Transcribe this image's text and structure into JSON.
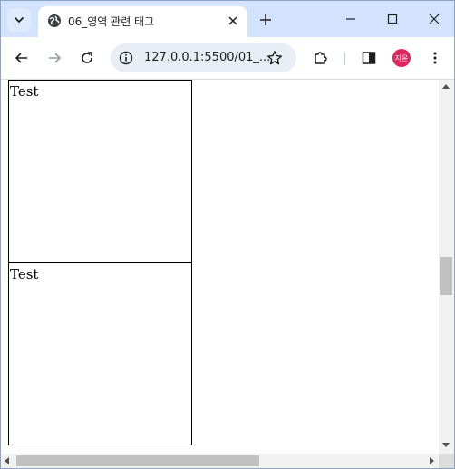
{
  "browser": {
    "tab": {
      "title": "06_영역 관련 태그"
    },
    "address_bar": {
      "url": "127.0.0.1:5500/01_..."
    },
    "profile": {
      "initials": "지윤",
      "color": "#e0245e"
    }
  },
  "page": {
    "boxes": [
      {
        "text": "Test"
      },
      {
        "text": "Test"
      }
    ]
  },
  "icons": {
    "tab_search": "chevron-down-icon",
    "favicon": "globe-icon",
    "tab_close": "close-icon",
    "new_tab": "plus-icon",
    "minimize": "minimize-icon",
    "maximize": "maximize-icon",
    "close_window": "close-icon",
    "back": "arrow-left-icon",
    "forward": "arrow-right-icon",
    "reload": "reload-icon",
    "site_info": "info-icon",
    "bookmark": "star-icon",
    "extensions": "puzzle-icon",
    "side_panel": "side-panel-icon",
    "menu": "kebab-menu-icon"
  },
  "colors": {
    "tabstrip_bg": "#d3e3fd",
    "omnibox_bg": "#e9eef6",
    "avatar_bg": "#e0245e"
  },
  "scroll": {
    "vertical_fraction": 0.47,
    "horizontal_fraction": 0
  }
}
